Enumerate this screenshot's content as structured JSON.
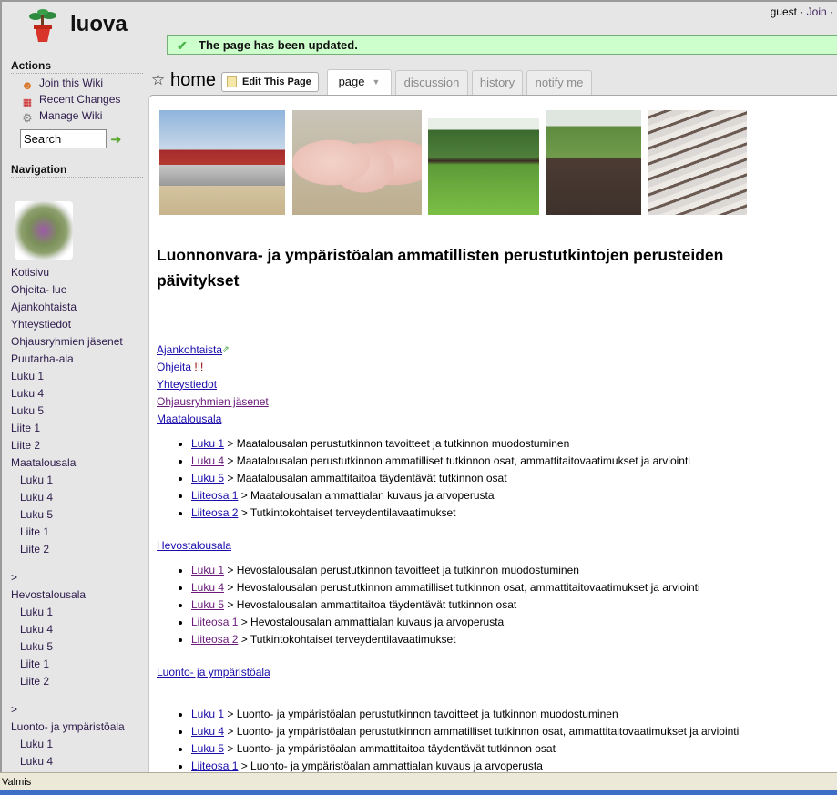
{
  "site": {
    "title": "luova",
    "logo_icon": "potted-bonsai-icon"
  },
  "userbar": {
    "user": "guest",
    "separator": "·",
    "join_label": "Join",
    "trailing": "·"
  },
  "notice": {
    "icon": "checkmark-icon",
    "text": "The page has been updated."
  },
  "sidebar": {
    "actions_heading": "Actions",
    "actions": [
      {
        "label": "Join this Wiki",
        "icon": "user-add-icon"
      },
      {
        "label": "Recent Changes",
        "icon": "calendar-icon"
      },
      {
        "label": "Manage Wiki",
        "icon": "gear-icon"
      }
    ],
    "search": {
      "value": "Search",
      "go_icon": "arrow-right-icon"
    },
    "navigation_heading": "Navigation",
    "nav_items": [
      {
        "label": "Kotisivu",
        "level": 0
      },
      {
        "label": "Ohjeita- lue",
        "level": 0
      },
      {
        "label": "Ajankohtaista",
        "level": 0
      },
      {
        "label": "Yhteystiedot",
        "level": 0
      },
      {
        "label": "Ohjausryhmien jäsenet",
        "level": 0
      },
      {
        "label": "Puutarha-ala",
        "level": 0
      },
      {
        "label": "Luku 1",
        "level": 0
      },
      {
        "label": "Luku 4",
        "level": 0
      },
      {
        "label": "Luku 5",
        "level": 0
      },
      {
        "label": "Liite 1",
        "level": 0
      },
      {
        "label": "Liite 2",
        "level": 0
      },
      {
        "label": "Maatalousala",
        "level": 0
      },
      {
        "label": "Luku 1",
        "level": 1
      },
      {
        "label": "Luku 4",
        "level": 1
      },
      {
        "label": "Luku 5",
        "level": 1
      },
      {
        "label": "Liite 1",
        "level": 1
      },
      {
        "label": "Liite 2",
        "level": 1
      },
      {
        "label": ">",
        "level": 0,
        "gap": true
      },
      {
        "label": "Hevostalousala",
        "level": 0
      },
      {
        "label": "Luku 1",
        "level": 1
      },
      {
        "label": "Luku 4",
        "level": 1
      },
      {
        "label": "Luku 5",
        "level": 1
      },
      {
        "label": "Liite 1",
        "level": 1
      },
      {
        "label": "Liite 2",
        "level": 1
      },
      {
        "label": ">",
        "level": 0,
        "gap": true
      },
      {
        "label": "Luonto- ja ympäristöala",
        "level": 0
      },
      {
        "label": "Luku 1",
        "level": 1
      },
      {
        "label": "Luku 4",
        "level": 1
      }
    ]
  },
  "page": {
    "name": "home",
    "edit_button": "Edit This Page",
    "tabs": [
      {
        "label": "page",
        "active": true,
        "has_caret": true
      },
      {
        "label": "discussion",
        "active": false
      },
      {
        "label": "history",
        "active": false
      },
      {
        "label": "notify me",
        "active": false
      }
    ],
    "photos": [
      {
        "name": "barn-tractor-photo"
      },
      {
        "name": "pigs-photo"
      },
      {
        "name": "horses-field-photo"
      },
      {
        "name": "tractor-field-photo"
      },
      {
        "name": "snowy-fence-photo"
      }
    ],
    "heading": "Luonnonvara- ja ympäristöalan ammatillisten perustutkintojen perusteiden päivitykset",
    "top_links": [
      {
        "label": "Ajankohtaista",
        "external": true
      },
      {
        "label": "Ohjeita",
        "suffix": "!!!"
      },
      {
        "label": "Yhteystiedot"
      },
      {
        "label": "Ohjausryhmien jäsenet",
        "visited": true
      },
      {
        "label": "Maatalousala"
      }
    ],
    "sections": [
      {
        "title": "Maatalousala",
        "title_is_top_link": true,
        "items": [
          {
            "link": "Luku 1",
            "text": " > Maatalousalan perustutkinnon tavoitteet ja tutkinnon muodostuminen"
          },
          {
            "link": "Luku 4",
            "text": " > Maatalousalan perustutkinnon ammatilliset tutkinnon osat, ammattitaitovaatimukset ja arviointi"
          },
          {
            "link": "Luku 5",
            "text": " > Maatalousalan ammattitaitoa täydentävät tutkinnon osat"
          },
          {
            "link": "Liiteosa 1",
            "text": " > Maatalousalan ammattialan kuvaus ja arvoperusta"
          },
          {
            "link": "Liiteosa 2",
            "text": " > Tutkintokohtaiset terveydentilavaatimukset"
          }
        ]
      },
      {
        "title": "Hevostalousala",
        "items": [
          {
            "link": "Luku 1",
            "text": " > Hevostalousalan perustutkinnon tavoitteet ja tutkinnon muodostuminen"
          },
          {
            "link": "Luku 4",
            "text": " > Hevostalousalan perustutkinnon ammatilliset tutkinnon osat, ammattitaitovaatimukset ja arviointi"
          },
          {
            "link": "Luku 5",
            "text": " > Hevostalousalan ammattitaitoa täydentävät tutkinnon osat"
          },
          {
            "link": "Liiteosa 1",
            "text": " > Hevostalousalan ammattialan kuvaus ja arvoperusta"
          },
          {
            "link": "Liiteosa 2",
            "text": " > Tutkintokohtaiset terveydentilavaatimukset"
          }
        ]
      },
      {
        "title": "Luonto- ja ympäristöala",
        "items": [
          {
            "link": "Luku 1",
            "text": " > Luonto- ja ympäristöalan perustutkinnon tavoitteet ja tutkinnon muodostuminen"
          },
          {
            "link": "Luku 4",
            "text": " > Luonto- ja ympäristöalan perustutkinnon ammatilliset tutkinnon osat, ammattitaitovaatimukset ja arviointi"
          },
          {
            "link": "Luku 5",
            "text": " > Luonto- ja ympäristöalan ammattitaitoa täydentävät tutkinnon osat"
          },
          {
            "link": "Liiteosa 1",
            "text": " > Luonto- ja ympäristöalan ammattialan kuvaus ja arvoperusta"
          }
        ]
      }
    ]
  },
  "statusbar": {
    "text": "Valmis"
  },
  "colors": {
    "notice_bg": "#ccffcc",
    "link": "#1a0dab",
    "visited_link": "#6a1b7a",
    "sidebar_bg": "#e6e6e6"
  }
}
